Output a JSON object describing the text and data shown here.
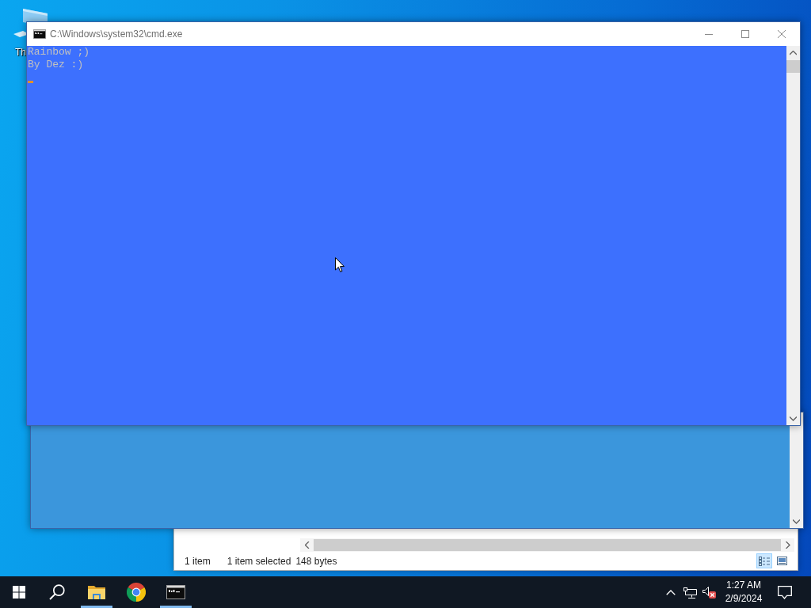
{
  "desktop": {
    "icons": [
      {
        "label": "Th"
      }
    ]
  },
  "windows": [
    {
      "kind": "explorer",
      "status_bar": {
        "item_count": "1 item",
        "selection": "1 item selected",
        "size": "148 bytes"
      },
      "view_buttons": [
        {
          "kind": "details",
          "selected": true
        },
        {
          "kind": "large-icons",
          "selected": false
        }
      ]
    },
    {
      "kind": "console",
      "color": "#3b96dc"
    },
    {
      "kind": "console",
      "color": "#3d70fe",
      "title": "C:\\Windows\\system32\\cmd.exe",
      "lines": [
        "Rainbow ;)",
        "By Dez :)"
      ]
    }
  ],
  "taskbar": {
    "buttons": [
      {
        "kind": "start",
        "running": false
      },
      {
        "kind": "search",
        "running": false
      },
      {
        "kind": "explorer",
        "running": true
      },
      {
        "kind": "chrome",
        "running": false
      },
      {
        "kind": "console",
        "running": true
      }
    ],
    "tray": {
      "muted": true
    },
    "clock": {
      "time": "1:27 AM",
      "date": "2/9/2024"
    }
  }
}
